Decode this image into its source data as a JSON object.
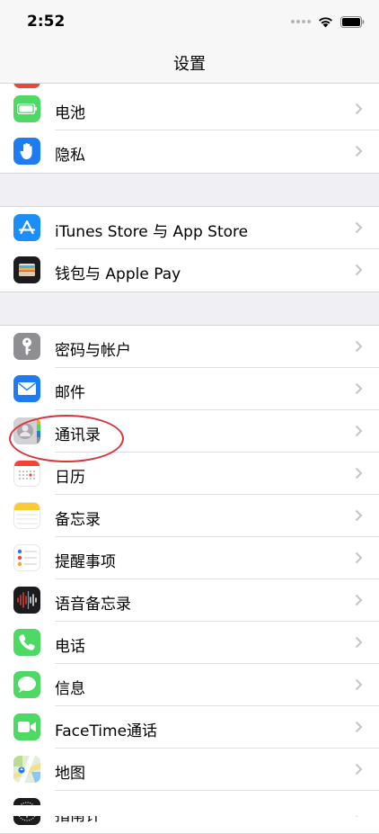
{
  "status_bar": {
    "time": "2:52"
  },
  "nav": {
    "title": "设置"
  },
  "colors": {
    "highlight": "#d6363a",
    "separator": "#e0e0e4",
    "background": "#efeff4"
  },
  "groups": [
    {
      "rows": [
        {
          "label": "电池",
          "icon": "battery-icon",
          "icon_bg": "#4cd964"
        },
        {
          "label": "隐私",
          "icon": "hand-icon",
          "icon_bg": "#1e7cf2"
        }
      ]
    },
    {
      "rows": [
        {
          "label": "iTunes Store 与 App Store",
          "icon": "app-store-icon",
          "icon_bg": "#1c8ef7"
        },
        {
          "label": "钱包与 Apple Pay",
          "icon": "wallet-icon",
          "icon_bg": "#1c1c1e"
        }
      ]
    },
    {
      "rows": [
        {
          "label": "密码与帐户",
          "icon": "key-icon",
          "icon_bg": "#8e8e93"
        },
        {
          "label": "邮件",
          "icon": "mail-icon",
          "icon_bg": "#1e7cf2"
        },
        {
          "label": "通讯录",
          "icon": "contacts-icon",
          "icon_bg": "#b9b9bd"
        },
        {
          "label": "日历",
          "icon": "calendar-icon",
          "icon_bg": "#ffffff"
        },
        {
          "label": "备忘录",
          "icon": "notes-icon",
          "icon_bg": "#ffffff"
        },
        {
          "label": "提醒事项",
          "icon": "reminders-icon",
          "icon_bg": "#ffffff"
        },
        {
          "label": "语音备忘录",
          "icon": "voice-memos-icon",
          "icon_bg": "#1c1c1e"
        },
        {
          "label": "电话",
          "icon": "phone-icon",
          "icon_bg": "#4cd964"
        },
        {
          "label": "信息",
          "icon": "messages-icon",
          "icon_bg": "#4cd964"
        },
        {
          "label": "FaceTime通话",
          "icon": "facetime-icon",
          "icon_bg": "#4cd964"
        },
        {
          "label": "地图",
          "icon": "maps-icon",
          "icon_bg": "#e8f0e0"
        },
        {
          "label": "指南针",
          "icon": "compass-icon",
          "icon_bg": "#1c1c1e"
        }
      ]
    }
  ]
}
